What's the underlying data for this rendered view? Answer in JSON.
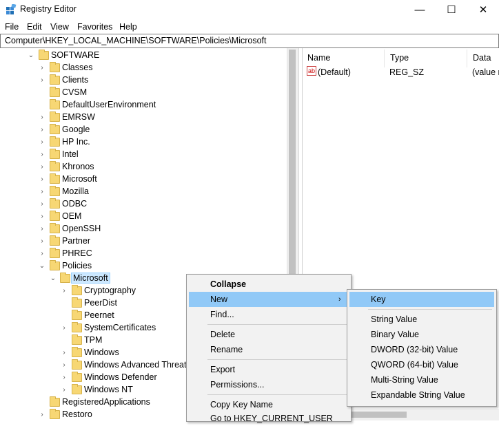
{
  "window": {
    "title": "Registry Editor",
    "minimize": "—",
    "maximize": "☐",
    "close": "✕"
  },
  "menubar": [
    "File",
    "Edit",
    "View",
    "Favorites",
    "Help"
  ],
  "address": "Computer\\HKEY_LOCAL_MACHINE\\SOFTWARE\\Policies\\Microsoft",
  "tree": {
    "software": "SOFTWARE",
    "software_children": [
      "Classes",
      "Clients",
      "CVSM",
      "DefaultUserEnvironment",
      "EMRSW",
      "Google",
      "HP Inc.",
      "Intel",
      "Khronos",
      "Microsoft",
      "Mozilla",
      "ODBC",
      "OEM",
      "OpenSSH",
      "Partner",
      "PHREC"
    ],
    "policies": "Policies",
    "selected": "Microsoft",
    "microsoft_children": [
      "Cryptography",
      "PeerDist",
      "Peernet",
      "SystemCertificates",
      "TPM",
      "Windows",
      "Windows Advanced Threat P",
      "Windows Defender",
      "Windows NT"
    ],
    "after": [
      "RegisteredApplications",
      "Restoro"
    ]
  },
  "values": {
    "headers": {
      "name": "Name",
      "type": "Type",
      "data": "Data"
    },
    "rows": [
      {
        "name": "(Default)",
        "type": "REG_SZ",
        "data": "(value n"
      }
    ]
  },
  "context_menu": {
    "collapse": "Collapse",
    "new": "New",
    "find": "Find...",
    "delete": "Delete",
    "rename": "Rename",
    "export": "Export",
    "permissions": "Permissions...",
    "copy_key_name": "Copy Key Name",
    "goto_hkcu": "Go to HKEY_CURRENT_USER"
  },
  "new_submenu": {
    "key": "Key",
    "string": "String Value",
    "binary": "Binary Value",
    "dword": "DWORD (32-bit) Value",
    "qword": "QWORD (64-bit) Value",
    "multi": "Multi-String Value",
    "expandable": "Expandable String Value"
  },
  "colors": {
    "highlight": "#91c9f7",
    "selected_bg": "#cce8ff",
    "folder": "#f7d774"
  }
}
